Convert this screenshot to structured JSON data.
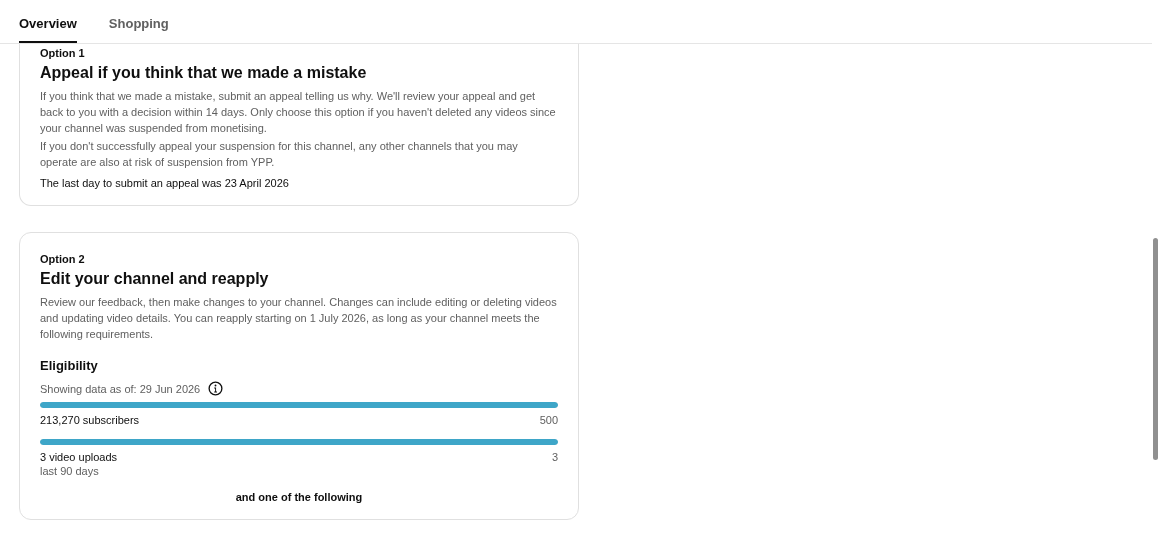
{
  "tabs": [
    {
      "label": "Overview",
      "selected": true
    },
    {
      "label": "Shopping",
      "selected": false
    }
  ],
  "options": [
    {
      "eyebrow": "Option 1",
      "title": "Appeal if you think that we made a mistake",
      "paragraphs": [
        "If you think that we made a mistake, submit an appeal telling us why. We'll review your appeal and get back to you with a decision within 14 days. Only choose this option if you haven't deleted any videos since your channel was suspended from monetising.",
        "If you don't successfully appeal your suspension for this channel, any other channels that you may operate are also at risk of suspension from YPP."
      ],
      "note": "The last day to submit an appeal was 23 April 2026"
    },
    {
      "eyebrow": "Option 2",
      "title": "Edit your channel and reapply",
      "paragraphs": [
        "Review our feedback, then make changes to your channel. Changes can include editing or deleting videos and updating video details. You can reapply starting on 1 July 2026, as long as your channel meets the following requirements."
      ],
      "eligibility": {
        "heading": "Eligibility",
        "data_date": "Showing data as of: 29 Jun 2026",
        "metrics": [
          {
            "label": "213,270 subscribers",
            "target": "500",
            "level": 1
          },
          {
            "label": "3 video uploads",
            "sublabel": "last 90 days",
            "target": "3",
            "level": 1
          }
        ],
        "footer": "and one of the following"
      }
    }
  ]
}
